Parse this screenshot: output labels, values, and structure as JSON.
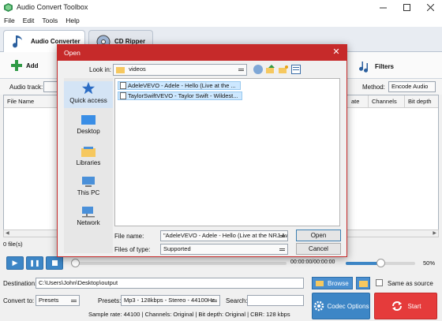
{
  "app": {
    "title": "Audio Convert Toolbox",
    "menu": [
      "File",
      "Edit",
      "Tools",
      "Help"
    ]
  },
  "tabs": [
    {
      "label": "Audio Converter"
    },
    {
      "label": "CD Ripper"
    }
  ],
  "toolbar": {
    "add_label": "Add",
    "filters_label": "Filters"
  },
  "options_row": {
    "audio_track_label": "Audio track:",
    "method_label": "Method:",
    "method_value": "Encode Audio"
  },
  "grid": {
    "columns": [
      "File Name",
      "ate",
      "Channels",
      "Bit depth"
    ]
  },
  "files_count": "0 file(s)",
  "player": {
    "time": "00:00:00/00:00:00",
    "volume": "50%",
    "volume_level": 0.5
  },
  "bottom": {
    "destination_label": "Destination:",
    "destination_value": "C:\\Users\\John\\Desktop\\output",
    "browse_label": "Browse",
    "same_as_source_label": "Same as source",
    "convert_to_label": "Convert to:",
    "convert_to_value": "Presets",
    "presets_label": "Presets:",
    "presets_value": "Mp3 - 128kbps - Stereo - 44100Hz",
    "search_label": "Search:",
    "codec_options_label": "Codec Options",
    "start_label": "Start",
    "info": "Sample rate: 44100 | Channels: Original | Bit depth: Original | CBR: 128 kbps"
  },
  "dialog": {
    "title": "Open",
    "look_in_label": "Look in:",
    "look_in_value": "videos",
    "places": [
      "Quick access",
      "Desktop",
      "Libraries",
      "This PC",
      "Network"
    ],
    "files": [
      "AdeleVEVO - Adele - Hello (Live at the ...",
      "TaylorSwiftVEVO - Taylor Swift - Wildest..."
    ],
    "file_name_label": "File name:",
    "file_name_value": "\"AdeleVEVO - Adele - Hello (Live at the NRJ Aw",
    "files_of_type_label": "Files of type:",
    "files_of_type_value": "Supported",
    "open_label": "Open",
    "cancel_label": "Cancel"
  },
  "colors": {
    "accent_blue": "#3d86c6",
    "dialog_red": "#c62a2a",
    "start_red": "#e53b3b"
  }
}
